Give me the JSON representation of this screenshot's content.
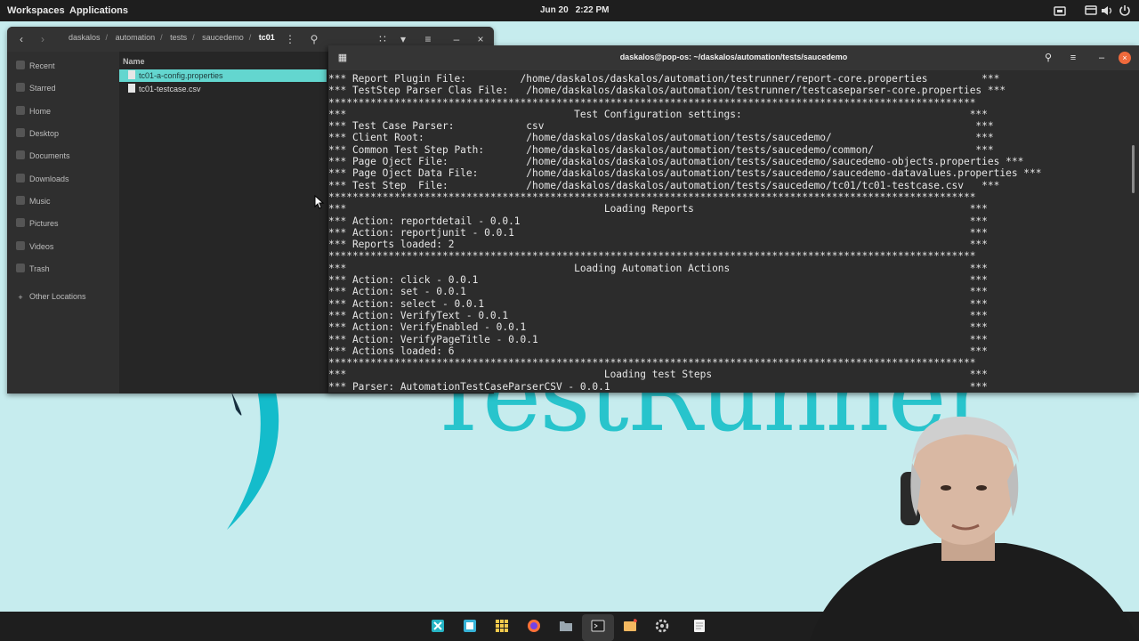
{
  "topbar": {
    "workspaces_label": "Workspaces",
    "applications_label": "Applications",
    "date": "Jun 20",
    "time": "2:22 PM"
  },
  "wallpaper": {
    "brand_text": "TestRunner"
  },
  "file_manager": {
    "breadcrumb": [
      "daskalos",
      "automation",
      "tests",
      "saucedemo"
    ],
    "breadcrumb_current": "tc01",
    "sidebar": [
      {
        "label": "Recent",
        "icon": "clock-icon"
      },
      {
        "label": "Starred",
        "icon": "star-icon"
      },
      {
        "label": "Home",
        "icon": "home-icon"
      },
      {
        "label": "Desktop",
        "icon": "desktop-icon"
      },
      {
        "label": "Documents",
        "icon": "documents-icon"
      },
      {
        "label": "Downloads",
        "icon": "downloads-icon"
      },
      {
        "label": "Music",
        "icon": "music-icon"
      },
      {
        "label": "Pictures",
        "icon": "pictures-icon"
      },
      {
        "label": "Videos",
        "icon": "videos-icon"
      },
      {
        "label": "Trash",
        "icon": "trash-icon"
      },
      {
        "label": "Other Locations",
        "icon": "plus-icon"
      }
    ],
    "column_header": "Name",
    "files": [
      {
        "name": "tc01-a-config.properties",
        "selected": true
      },
      {
        "name": "tc01-testcase.csv",
        "selected": false
      }
    ]
  },
  "terminal": {
    "title": "daskalos@pop-os: ~/daskalos/automation/tests/saucedemo",
    "lines": [
      "*** Report Plugin File:         /home/daskalos/daskalos/automation/testrunner/report-core.properties         ***",
      "*** TestStep Parser Clas File:   /home/daskalos/daskalos/automation/testrunner/testcaseparser-core.properties ***",
      "************************************************************************************************************",
      "***                                      Test Configuration settings:                                      ***",
      "*** Test Case Parser:            csv                                                                        ***",
      "*** Client Root:                 /home/daskalos/daskalos/automation/tests/saucedemo/                        ***",
      "*** Common Test Step Path:       /home/daskalos/daskalos/automation/tests/saucedemo/common/                 ***",
      "*** Page Oject File:             /home/daskalos/daskalos/automation/tests/saucedemo/saucedemo-objects.properties ***",
      "*** Page Oject Data File:        /home/daskalos/daskalos/automation/tests/saucedemo/saucedemo-datavalues.properties ***",
      "*** Test Step  File:             /home/daskalos/daskalos/automation/tests/saucedemo/tc01/tc01-testcase.csv   ***",
      "************************************************************************************************************",
      "***                                           Loading Reports                                              ***",
      "*** Action: reportdetail - 0.0.1                                                                           ***",
      "*** Action: reportjunit - 0.0.1                                                                            ***",
      "*** Reports loaded: 2                                                                                      ***",
      "************************************************************************************************************",
      "***                                      Loading Automation Actions                                        ***",
      "*** Action: click - 0.0.1                                                                                  ***",
      "*** Action: set - 0.0.1                                                                                    ***",
      "*** Action: select - 0.0.1                                                                                 ***",
      "*** Action: VerifyText - 0.0.1                                                                             ***",
      "*** Action: VerifyEnabled - 0.0.1                                                                          ***",
      "*** Action: VerifyPageTitle - 0.0.1                                                                        ***",
      "*** Actions loaded: 6                                                                                      ***",
      "************************************************************************************************************",
      "***                                           Loading test Steps                                           ***",
      "*** Parser: AutomationTestCaseParserCSV - 0.0.1                                                            ***"
    ]
  },
  "dock": {
    "apps": [
      "workspaces-icon",
      "app-grid-icon",
      "launcher-icon",
      "firefox-icon",
      "files-icon",
      "terminal-icon",
      "store-icon",
      "settings-icon",
      "text-editor-icon"
    ]
  },
  "colors": {
    "accent": "#63d6cf",
    "wallpaper": "#c6ecee",
    "brand_teal": "#28c4cc",
    "terminal_bg": "#2c2c2c",
    "close_orange": "#f06a3c"
  }
}
